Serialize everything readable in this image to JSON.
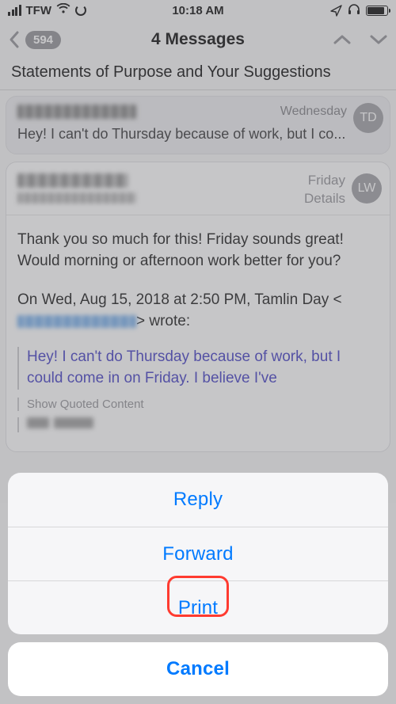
{
  "status": {
    "carrier": "TFW",
    "time": "10:18 AM"
  },
  "nav": {
    "back_count": "594",
    "title": "4 Messages"
  },
  "subject": "Statements of Purpose and Your Suggestions",
  "msg1": {
    "date": "Wednesday",
    "avatar": "TD",
    "preview": "Hey! I can't do Thursday because of work, but I co..."
  },
  "msg2": {
    "date": "Friday",
    "details": "Details",
    "avatar": "LW",
    "body_p1": "Thank you so much for this! Friday sounds great! Would morning or afternoon work better for you?",
    "body_p2_a": "On Wed, Aug 15, 2018 at 2:50 PM, Tamlin Day <",
    "body_p2_b": "> wrote:",
    "quote": "Hey! I can't do Thursday because of work, but I could come in on Friday. I believe I've",
    "show_quoted": "Show Quoted Content"
  },
  "sheet": {
    "reply": "Reply",
    "forward": "Forward",
    "print": "Print",
    "cancel": "Cancel"
  }
}
